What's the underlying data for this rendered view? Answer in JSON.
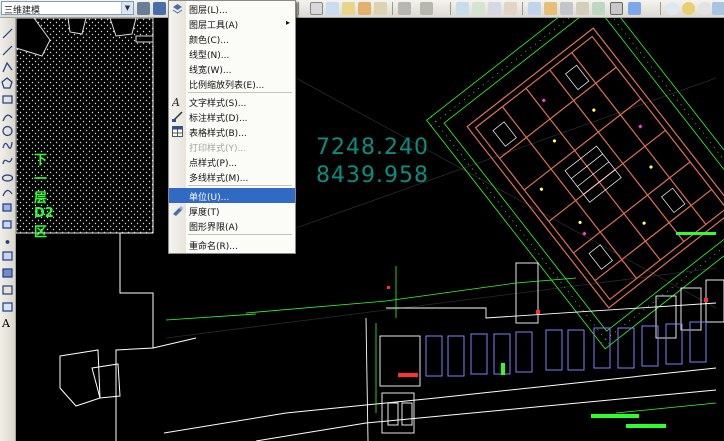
{
  "toolbar": {
    "workspace_value": "三维建模",
    "dropdown_glyph": "▼"
  },
  "menu": {
    "items": [
      {
        "label": "图层(L)...",
        "icon": "layers-icon"
      },
      {
        "label": "图层工具(A)",
        "submenu_arrow": "▸"
      },
      {
        "label": "颜色(C)..."
      },
      {
        "label": "线型(N)..."
      },
      {
        "label": "线宽(W)..."
      },
      {
        "label": "比例缩放列表(E)..."
      },
      {
        "label": "文字样式(S)...",
        "icon": "text-style-icon"
      },
      {
        "label": "标注样式(D)...",
        "icon": "dimension-style-icon"
      },
      {
        "label": "表格样式(B)...",
        "icon": "table-style-icon"
      },
      {
        "label": "打印样式(Y)...",
        "disabled": true
      },
      {
        "label": "点样式(P)..."
      },
      {
        "label": "多线样式(M)..."
      },
      {
        "label": "单位(U)...",
        "highlighted": true
      },
      {
        "label": "厚度(T)",
        "icon": "thickness-icon"
      },
      {
        "label": "图形界限(A)"
      },
      {
        "label": "重命名(R)..."
      }
    ]
  },
  "palette": {
    "text_tool": "A"
  },
  "canvas": {
    "coord_1": "7248.240",
    "coord_2": "8439.958",
    "zone_label": "下一层D2区"
  },
  "colors": {
    "highlight": "#316ac5",
    "canvas_bg": "#000000",
    "coord_text": "#0a8d7e",
    "zone_text": "#2cff2c",
    "building_outline": "#e07050",
    "dimension_lines": "#2cff2c",
    "walls": "#ffffff"
  }
}
